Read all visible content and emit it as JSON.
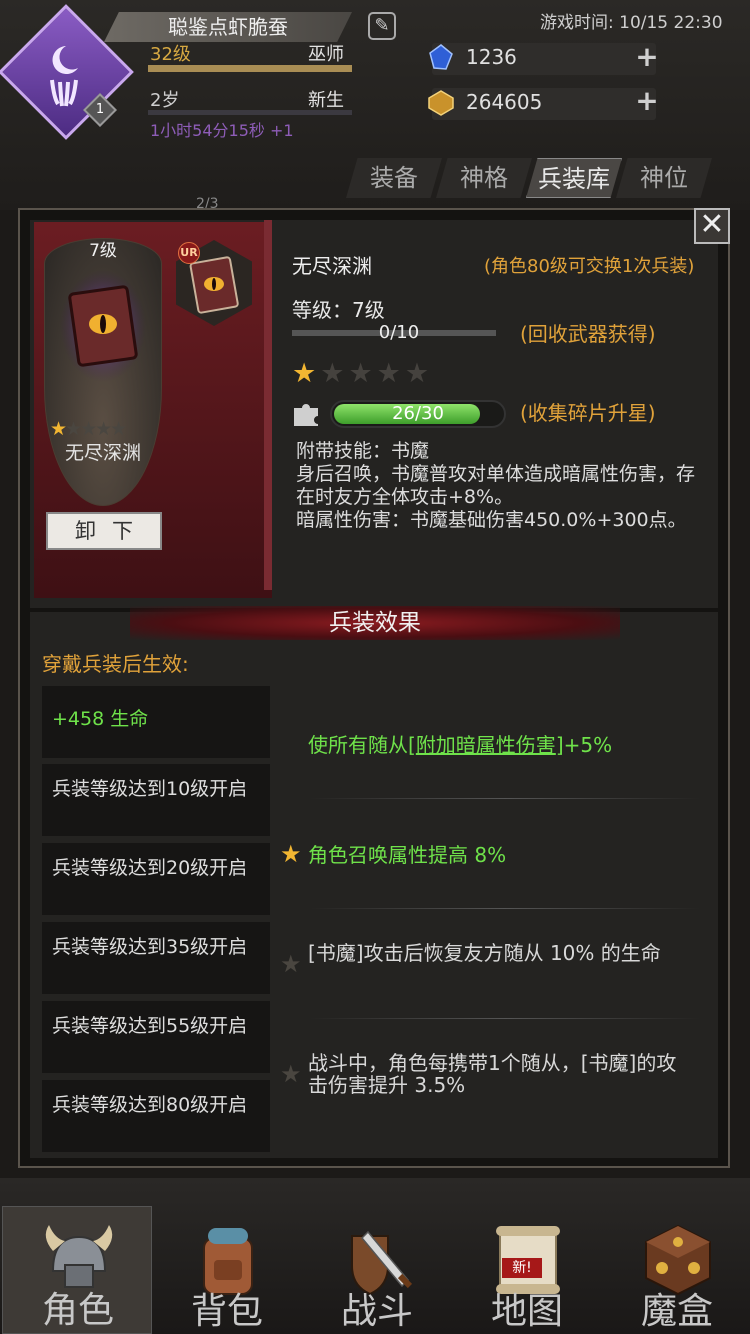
{
  "header": {
    "player_name": "聪鉴点虾脆蚕",
    "avatar_level": "1",
    "game_time": "游戏时间: 10/15 22:30",
    "level": "32级",
    "class": "巫师",
    "age": "2岁",
    "stage": "新生",
    "age_timer": "1小时54分15秒 +1",
    "crystals": "1236",
    "gold": "264605",
    "marker": "2/3"
  },
  "tabs": [
    {
      "label": "装备",
      "active": false
    },
    {
      "label": "神格",
      "active": false
    },
    {
      "label": "兵装库",
      "active": true
    },
    {
      "label": "神位",
      "active": false
    }
  ],
  "item": {
    "card_level": "7级",
    "card_name": "无尽深渊",
    "card_stars": "★☆☆☆☆",
    "unequip_label": "卸下",
    "rarity": "UR",
    "name": "无尽深渊",
    "swap_note": "(角色80级可交换1次兵装)",
    "grade_label": "等级：7级",
    "exp_text": "0/10",
    "exp_progress": 0,
    "recycle_note": "(回收武器获得)",
    "stars_filled": 1,
    "stars_total": 5,
    "fragments_text": "26/30",
    "fragments_progress": 0.8667,
    "collect_note": "(收集碎片升星)",
    "desc_lines": [
      "附带技能：书魔",
      "身后召唤，书魔普攻对单体造成暗属性伤害，存在时友方全体攻击+8%。",
      "暗属性伤害：书魔基础伤害450.0%+300点。"
    ]
  },
  "effects": {
    "title": "兵装效果",
    "wear_note": "穿戴兵装后生效:",
    "conditions": [
      "+458 生命",
      "兵装等级达到10级开启",
      "兵装等级达到20级开启",
      "兵装等级达到35级开启",
      "兵装等级达到55级开启",
      "兵装等级达到80级开启"
    ],
    "bonus_1_prefix": "使所有随从[",
    "bonus_1_link": "附加暗属性伤害",
    "bonus_1_suffix": "]+5%",
    "bonus_2": "角色召唤属性提高 8%",
    "bonus_3": "[书魔]攻击后恢复友方随从 10% 的生命",
    "bonus_4": "战斗中，角色每携带1个随从，[书魔]的攻击伤害提升 3.5%"
  },
  "nav": [
    {
      "label": "角色",
      "icon": "helmet-icon",
      "active": true
    },
    {
      "label": "背包",
      "icon": "backpack-icon",
      "active": false
    },
    {
      "label": "战斗",
      "icon": "sword-shield-icon",
      "active": false
    },
    {
      "label": "地图",
      "icon": "scroll-map-icon",
      "active": false,
      "badge": "新!"
    },
    {
      "label": "魔盒",
      "icon": "magic-box-icon",
      "active": false
    }
  ],
  "colors": {
    "accent_orange": "#e0a23a",
    "green": "#6fe24a",
    "banner_red": "#6b1d22",
    "purple": "#8e5db8"
  }
}
